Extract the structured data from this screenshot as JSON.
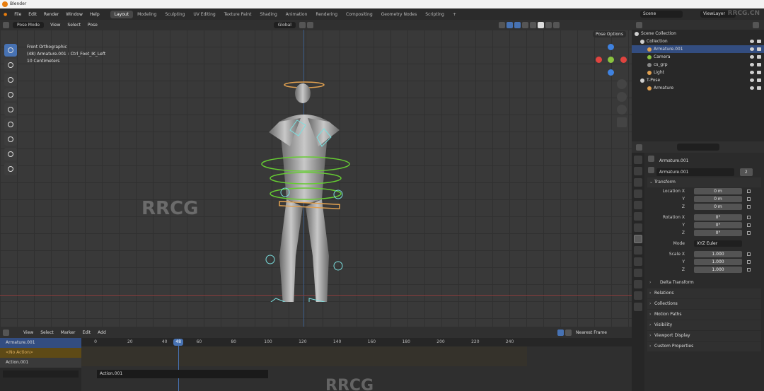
{
  "app": {
    "title": "Blender"
  },
  "menu": [
    "File",
    "Edit",
    "Render",
    "Window",
    "Help"
  ],
  "workspaces": [
    {
      "label": "Layout",
      "active": true
    },
    {
      "label": "Modeling"
    },
    {
      "label": "Sculpting"
    },
    {
      "label": "UV Editing"
    },
    {
      "label": "Texture Paint"
    },
    {
      "label": "Shading"
    },
    {
      "label": "Animation"
    },
    {
      "label": "Rendering"
    },
    {
      "label": "Compositing"
    },
    {
      "label": "Geometry Nodes"
    },
    {
      "label": "Scripting"
    },
    {
      "label": "+"
    }
  ],
  "scene": {
    "name": "Scene",
    "view_layer": "ViewLayer"
  },
  "viewport_header": {
    "mode": "Pose Mode",
    "items": [
      "View",
      "Select",
      "Pose"
    ],
    "orientation": "Global",
    "pose_options": "Pose Options"
  },
  "viewport_info": {
    "line1": "Front Orthographic",
    "line2": "(48) Armature.001 : Ctrl_Foot_IK_Left",
    "line3": "10 Centimeters"
  },
  "gizmo_colors": {
    "x": "#e0443f",
    "y": "#8ac33f",
    "z": "#3f82e0"
  },
  "outliner": {
    "rows": [
      {
        "label": "Scene Collection",
        "indent": 4,
        "dot": "#cfcfcf"
      },
      {
        "label": "Collection",
        "indent": 12,
        "dot": "#cfcfcf"
      },
      {
        "label": "Armature.001",
        "indent": 22,
        "dot": "#e0a050",
        "selected": true
      },
      {
        "label": "Camera",
        "indent": 22,
        "dot": "#8ac33f"
      },
      {
        "label": "cs_grp",
        "indent": 22,
        "dot": "#888888"
      },
      {
        "label": "Light",
        "indent": 22,
        "dot": "#e0a050"
      },
      {
        "label": "T-Pose",
        "indent": 12,
        "dot": "#cfcfcf"
      },
      {
        "label": "Armature",
        "indent": 22,
        "dot": "#e0a050"
      }
    ]
  },
  "properties": {
    "object_name": "Armature.001",
    "data_name": "Armature.001",
    "users": "2",
    "transform_label": "Transform",
    "location": {
      "label": "Location X",
      "x": "0 m",
      "y": "0 m",
      "z": "0 m"
    },
    "rotation": {
      "label": "Rotation X",
      "x": "0°",
      "y": "0°",
      "z": "0°"
    },
    "mode": {
      "label": "Mode",
      "value": "XYZ Euler"
    },
    "scale": {
      "label": "Scale X",
      "x": "1.000",
      "y": "1.000",
      "z": "1.000"
    },
    "axis_y": "Y",
    "axis_z": "Z",
    "sections": [
      "Delta Transform",
      "Relations",
      "Collections",
      "Motion Paths",
      "Visibility",
      "Viewport Display",
      "Custom Properties"
    ]
  },
  "timeline": {
    "header_items": [
      "View",
      "Select",
      "Marker",
      "Edit",
      "Add"
    ],
    "nearest_frame": "Nearest Frame",
    "current_frame": "48",
    "current_frame_value": 48,
    "ticks": [
      0,
      20,
      40,
      60,
      80,
      100,
      120,
      140,
      160,
      180,
      200,
      220,
      240
    ],
    "channels": [
      {
        "label": "Armature.001",
        "type": "obj"
      },
      {
        "label": "<No Action>",
        "type": "noaction"
      },
      {
        "label": "Action.001",
        "type": "action"
      }
    ],
    "action_strip": "Action.001"
  },
  "watermark": {
    "top": "RRCG.CN",
    "center": "RRCG",
    "bottom": "RRCG"
  }
}
